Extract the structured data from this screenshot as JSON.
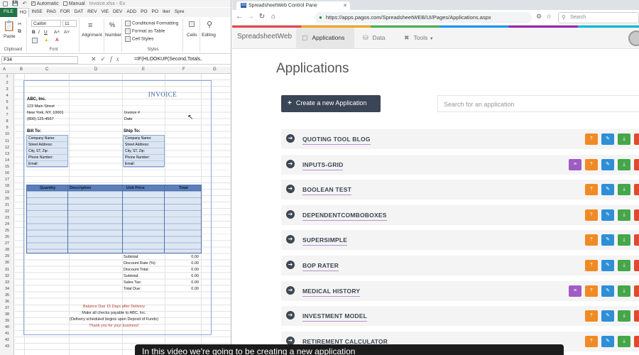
{
  "excel": {
    "title_controls": [
      "Automatic",
      "Manual",
      "Invoice.xlsx - Ex"
    ],
    "tabs": [
      "FILE",
      "HO",
      "INSE",
      "PAG",
      "FOR",
      "DAT",
      "REV",
      "VIE",
      "DEV",
      "ADD",
      "PO",
      "PO",
      "Iker",
      "Spre"
    ],
    "ribbon": {
      "paste": "Paste",
      "clipboard": "Clipboard",
      "font_name": "Calibri",
      "font_size": "11",
      "font": "Font",
      "alignment": "Alignment",
      "number": "Number",
      "number_symbol": "%",
      "conditional_formatting": "Conditional Formatting",
      "format_as_table": "Format as Table",
      "cell_styles": "Cell Styles",
      "styles": "Styles",
      "cells": "Cells",
      "editing": "Editing"
    },
    "name_box": "F34",
    "formula": "=IF(HLOOKUP(Second,Totals,",
    "columns": [
      "A",
      "B",
      "C",
      "D",
      "E",
      "F",
      "G"
    ],
    "rows": [
      "1",
      "2",
      "3",
      "4",
      "5",
      "6",
      "7",
      "8",
      "9",
      "10",
      "11",
      "12",
      "13",
      "14",
      "15",
      "16",
      "17",
      "18",
      "19",
      "20",
      "21",
      "22",
      "23",
      "24",
      "25",
      "26",
      "27",
      "28",
      "29",
      "30",
      "31",
      "32",
      "33",
      "34",
      "35",
      "36",
      "37",
      "38",
      "39",
      "40",
      "41",
      "42",
      "43"
    ],
    "invoice": {
      "title": "INVOICE",
      "company": "ABC, Inc.",
      "address1": "123 Main Street",
      "address2": "New York, NY, 10001",
      "phone": "(800) 125-4567",
      "invoice_no_label": "Invoice #",
      "date_label": "Date",
      "bill_to": "Bill To:",
      "ship_to": "Ship To:",
      "bill_fields": [
        "Company Name:",
        "Street Address:",
        "City, ST, Zip:",
        "Phone Number:",
        "Email:"
      ],
      "ship_fields": [
        "Company Name:",
        "Street Address:",
        "City, ST, Zip:",
        "Phone Number:",
        "Email:"
      ],
      "item_headers": [
        "Quantity",
        "Description",
        "Unit Price",
        "Total"
      ],
      "totals": [
        {
          "label": "Subtotal:",
          "value": "0.00"
        },
        {
          "label": "Discount Rate (%):",
          "value": "0.00"
        },
        {
          "label": "Discount Total:",
          "value": "0.00"
        },
        {
          "label": "Subtotal:",
          "value": "0.00"
        },
        {
          "label": "Sales Tax:",
          "value": "0.00"
        },
        {
          "label": "Total Due:",
          "value": "0.00"
        }
      ],
      "footer": [
        "Balance Due 15 Days after Delivery",
        "Make all checks payable to ABC, Inc.",
        "(Delivery scheduled begins upon Deposit of Funds)",
        "Thank you for your business!"
      ]
    }
  },
  "browser": {
    "tab_title": "SpreadsheetWeb Control Pane",
    "favicon": "SS",
    "url": "https://apps.pagos.com/SpreadsheetWEB/UI/Pages/Applications.aspx",
    "search_placeholder": "Search",
    "nav": {
      "brand": "SpreadsheetWeb",
      "items": [
        "Applications",
        "Data",
        "Tools"
      ]
    },
    "page_title": "Applications",
    "create_button": "Create a new Application",
    "app_search_placeholder": "Search for an application",
    "apps": [
      {
        "name": "QUOTING TOOL BLOG",
        "db": false
      },
      {
        "name": "INPUTS-GRID",
        "db": true
      },
      {
        "name": "BOOLEAN TEST",
        "db": false
      },
      {
        "name": "DEPENDENTCOMBOBOXES",
        "db": false
      },
      {
        "name": "SUPERSIMPLE",
        "db": false
      },
      {
        "name": "BOP RATER",
        "db": false
      },
      {
        "name": "MEDICAL HISTORY",
        "db": true
      },
      {
        "name": "INVESTMENT MODEL",
        "db": false
      },
      {
        "name": "RETIREMENT CALCULATOR",
        "db": false
      }
    ],
    "action_colors": {
      "db": "#a05cc4",
      "upload": "#f08a24",
      "edit": "#2f8fd6",
      "download": "#46a64a",
      "delete": "#e0492f"
    }
  },
  "caption": "In this video we're going to be creating a new application"
}
